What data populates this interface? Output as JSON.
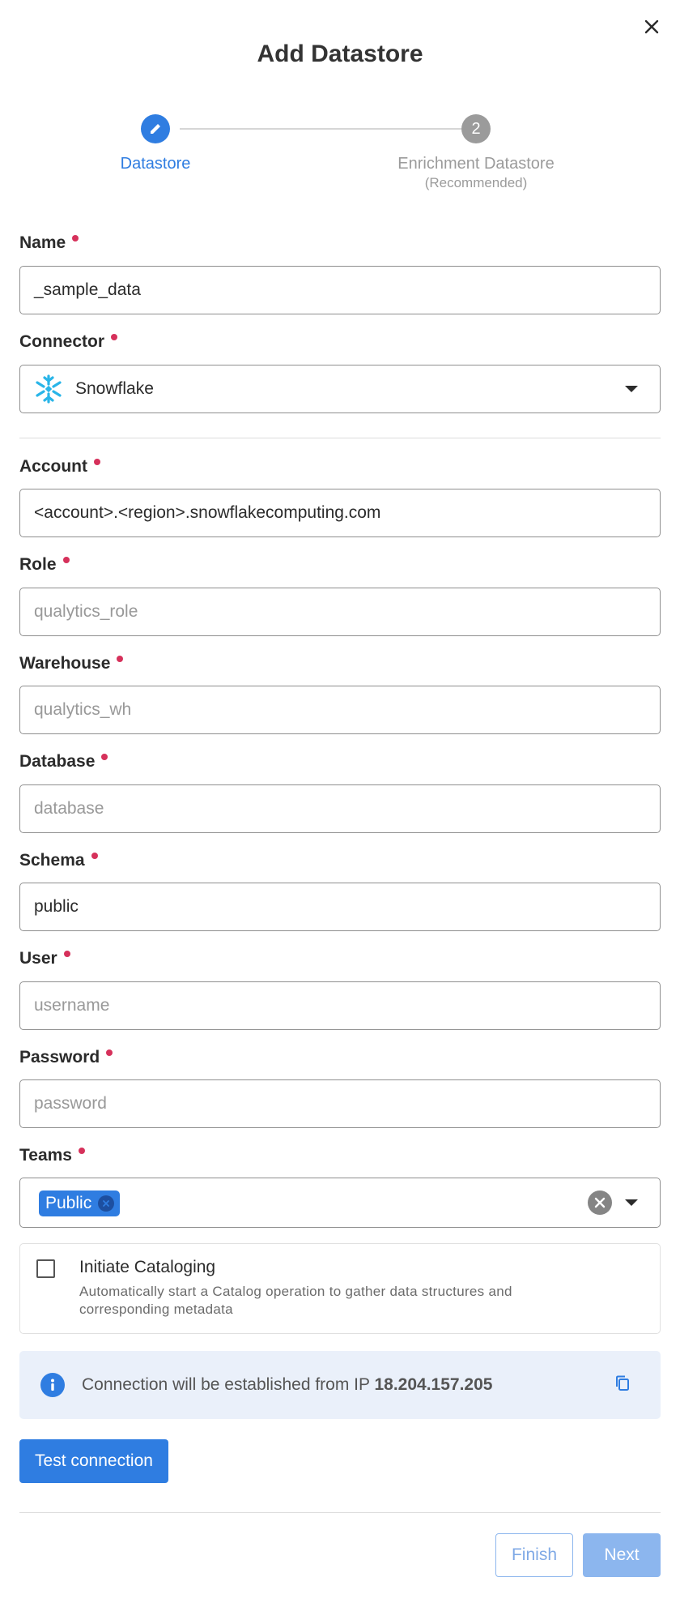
{
  "dialog": {
    "title": "Add Datastore"
  },
  "stepper": {
    "step1_label": "Datastore",
    "step2_number": "2",
    "step2_label": "Enrichment Datastore",
    "step2_sub": "(Recommended)"
  },
  "form": {
    "name": {
      "label": "Name",
      "value": "_sample_data"
    },
    "connector": {
      "label": "Connector",
      "value": "Snowflake",
      "icon": "snowflake-icon"
    },
    "account": {
      "label": "Account",
      "value": "<account>.<region>.snowflakecomputing.com"
    },
    "role": {
      "label": "Role",
      "placeholder": "qualytics_role"
    },
    "warehouse": {
      "label": "Warehouse",
      "placeholder": "qualytics_wh"
    },
    "database": {
      "label": "Database",
      "placeholder": "database"
    },
    "schema": {
      "label": "Schema",
      "value": "public"
    },
    "user": {
      "label": "User",
      "placeholder": "username"
    },
    "password": {
      "label": "Password",
      "placeholder": "password"
    },
    "teams": {
      "label": "Teams",
      "chips": [
        "Public"
      ]
    }
  },
  "cataloging": {
    "title": "Initiate Cataloging",
    "description": "Automatically start a Catalog operation to gather data structures and corresponding metadata",
    "checked": false
  },
  "info": {
    "text": "Connection will be established from IP",
    "ip": "18.204.157.205"
  },
  "buttons": {
    "test_connection": "Test connection",
    "finish": "Finish",
    "next": "Next"
  },
  "colors": {
    "accent": "#2f7de1",
    "required": "#d6315b",
    "disabled_accent": "#8cb6ee"
  }
}
